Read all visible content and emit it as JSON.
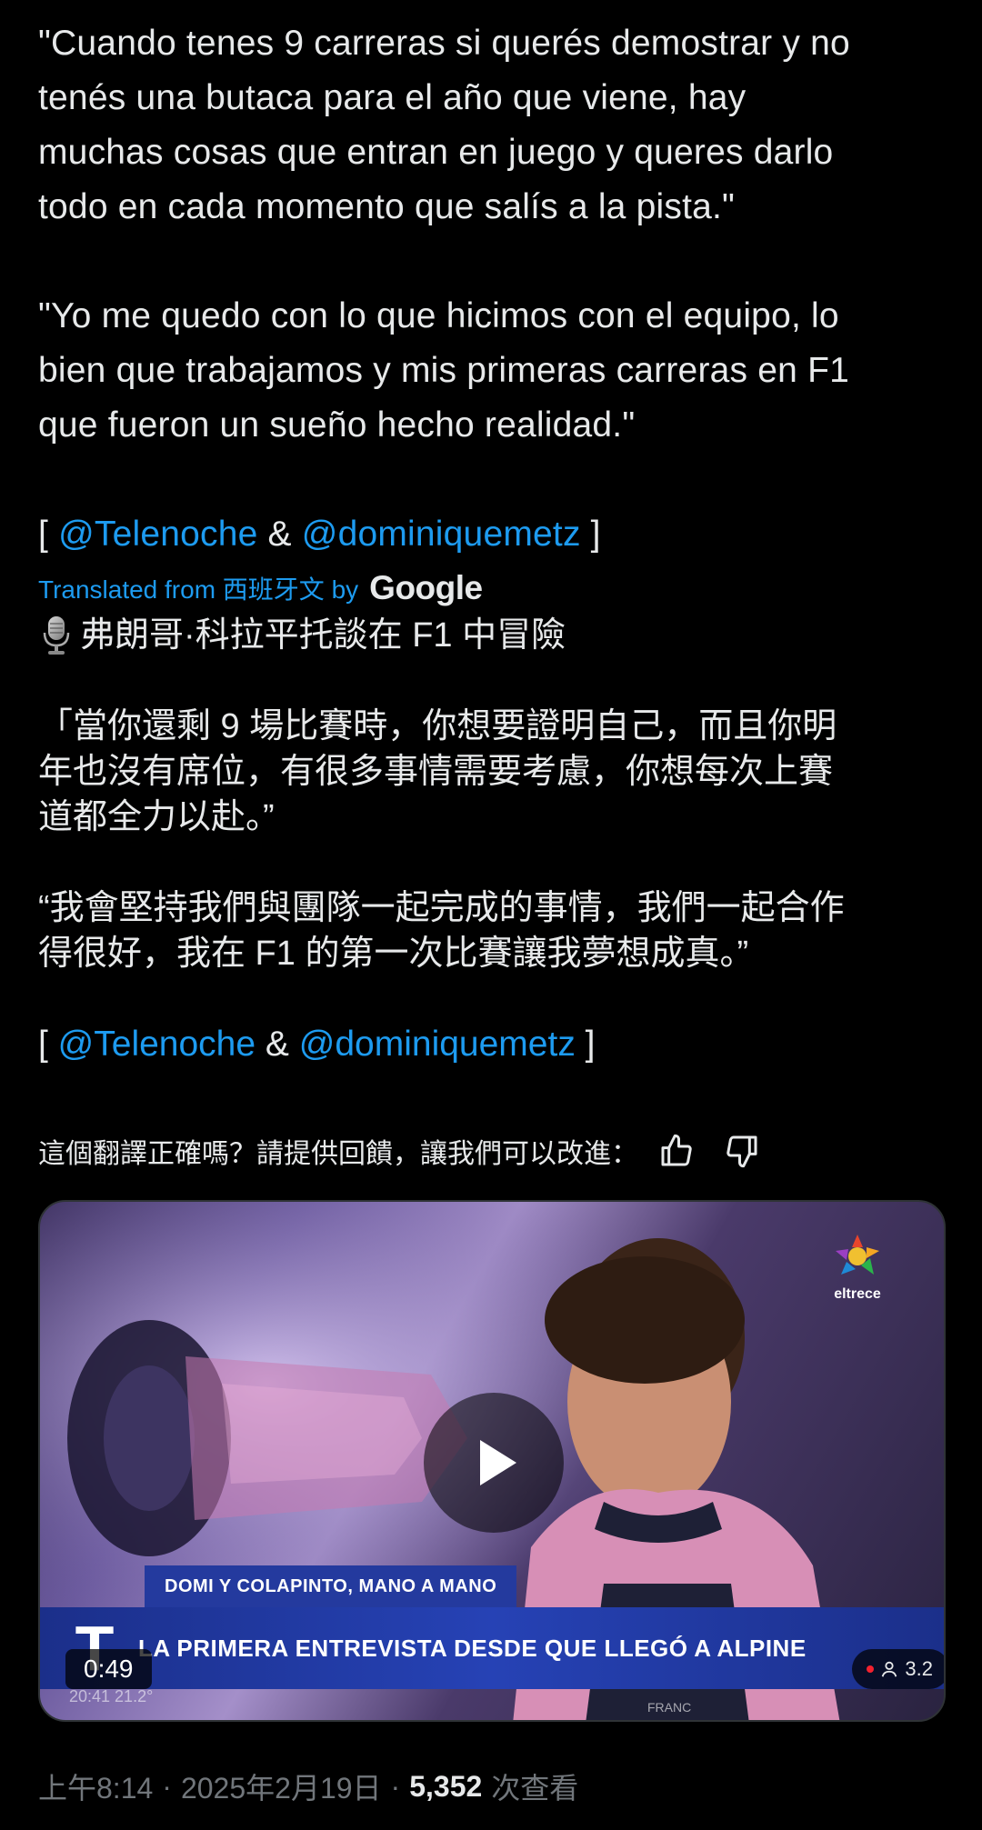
{
  "tweet": {
    "original": {
      "p1": [
        "\"Cuando tenes 9 carreras si querés demostrar y no",
        "tenés una butaca para el año que viene, hay",
        "muchas cosas que entran en juego y queres darlo",
        "todo en cada momento que salís a la pista.\""
      ],
      "p2": [
        "\"Yo me quedo con lo que hicimos con el equipo, lo",
        "bien que trabajamos y mis primeras carreras en F1",
        "que fueron un sueño hecho realidad.\""
      ],
      "credit_open": "[ ",
      "mention1": "@Telenoche",
      "amp": " & ",
      "mention2": "@dominiquemetz",
      "credit_close": " ]"
    },
    "translation": {
      "label": "Translated from 西班牙文 by",
      "provider": "Google",
      "title": "弗朗哥·科拉平托談在 F1 中冒險",
      "q1": [
        "「當你還剩 9 場比賽時，你想要證明自己，而且你明",
        "年也沒有席位，有很多事情需要考慮，你想每次上賽",
        "道都全力以赴。”"
      ],
      "q2": [
        "“我會堅持我們與團隊一起完成的事情，我們一起合作",
        "得很好，我在 F1 的第一次比賽讓我夢想成真。”"
      ],
      "credit_open": "[ ",
      "mention1": "@Telenoche",
      "amp": " & ",
      "mention2": "@dominiquemetz",
      "credit_close": " ]"
    },
    "feedback": {
      "prompt": "這個翻譯正確嗎？請提供回饋，讓我們可以改進：",
      "like_icon": "thumbs-up-icon",
      "dislike_icon": "thumbs-down-icon"
    },
    "video": {
      "channel": "eltrece",
      "lower_third_top": "DOMI Y COLAPINTO, MANO A MANO",
      "lower_third_logo": "T",
      "headline": "LA PRIMERA ENTREVISTA DESDE QUE LLEGÓ A ALPINE",
      "duration": "0:49",
      "overlay_info": "20:41   21.2°",
      "viewer_count": "3.2",
      "background_text": "FRANC"
    },
    "meta": {
      "time": "上午8:14",
      "sep1": "·",
      "date": "2025年2月19日",
      "sep2": "·",
      "views_count": "5,352",
      "views_label": "次查看"
    },
    "colors": {
      "background": "#000000",
      "text": "#e7e9ea",
      "link": "#1d9bf0",
      "muted": "#71767b",
      "banner": "#243a9e"
    }
  }
}
